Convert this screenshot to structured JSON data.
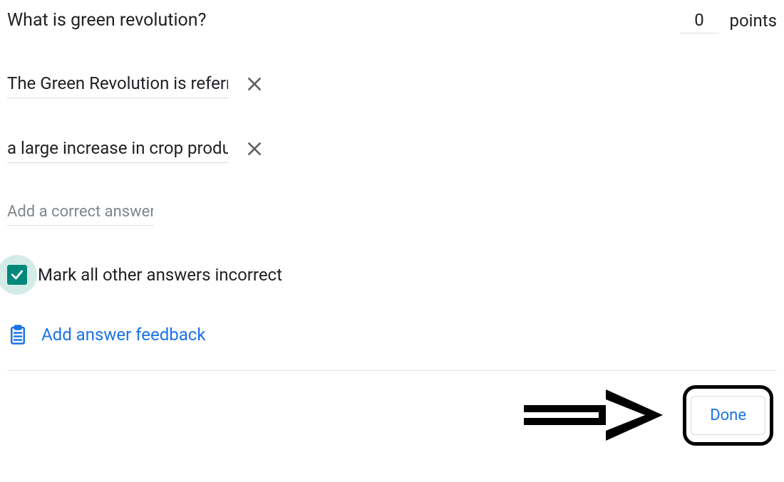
{
  "question": {
    "title": "What is green revolution?",
    "points_value": "0",
    "points_label": "points"
  },
  "answers": [
    {
      "value": "The Green Revolution is referred"
    },
    {
      "value": "a large increase in crop product"
    }
  ],
  "add_answer_placeholder": "Add a correct answer",
  "checkbox": {
    "label": "Mark all other answers incorrect",
    "checked": true
  },
  "feedback_link": "Add answer feedback",
  "done_label": "Done"
}
